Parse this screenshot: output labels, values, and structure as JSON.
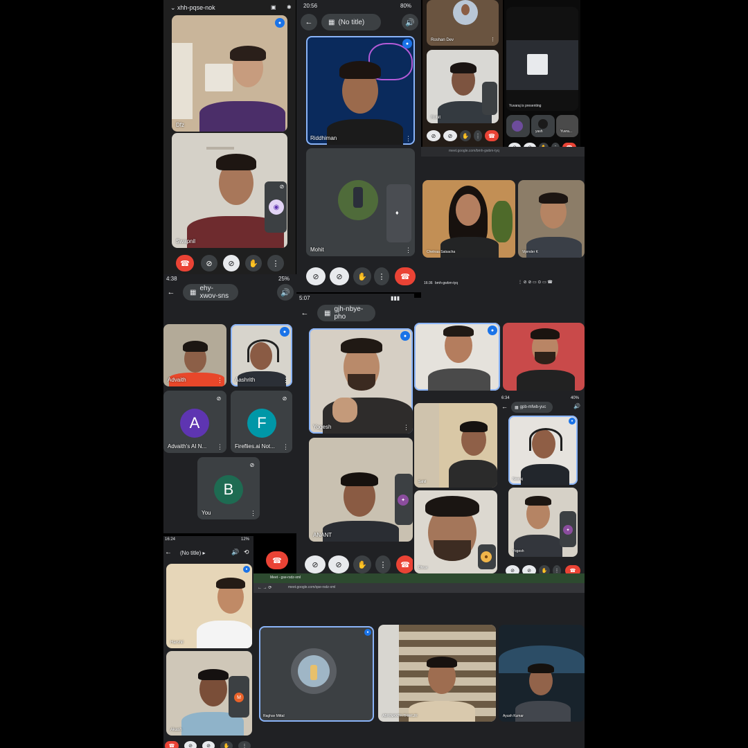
{
  "panel1": {
    "status_left": "xhh-pqse-nok",
    "participants": [
      "Dfz",
      "Swapnil"
    ]
  },
  "panel2": {
    "status_time": "20:56",
    "battery": "80%",
    "title": "(No title)",
    "participants": [
      "Riddhiman",
      "Mohit"
    ]
  },
  "panel3": {
    "participants": [
      "Roshan Dev",
      "Rohit"
    ],
    "presenting": "Yuvaraj is presenting",
    "thumbs": [
      "yash",
      "Yuvra..."
    ]
  },
  "panel4": {
    "url": "meet.google.com/bmh-gwbm-tyq",
    "participants": [
      "Chetnaa Satsacha",
      "Vijender K"
    ],
    "footer_time": "16:36",
    "footer_code": "bmh-gwbm-tyq"
  },
  "panel5": {
    "status_time": "4:38",
    "battery": "25%",
    "meeting_code": "ehy-xwov-sns",
    "participants": [
      "Advaith",
      "Aashrith"
    ],
    "ai_tiles": [
      {
        "letter": "A",
        "name": "Advaith's AI N...",
        "color": "#5e35b1"
      },
      {
        "letter": "F",
        "name": "Fireflies.ai Not...",
        "color": "#0097a7"
      },
      {
        "letter": "B",
        "name": "You",
        "color": "#1e6b52"
      }
    ]
  },
  "panel6": {
    "status_time": "5:07",
    "meeting_code": "gjh-nbye-pho",
    "participants": [
      "Yogesh",
      "ANANT"
    ]
  },
  "panel7": {
    "participants": [
      "",
      "",
      "Sahil",
      "Dhruv"
    ]
  },
  "panel8": {
    "status_time": "6:34",
    "battery": "40%",
    "meeting_code": "gpb-mfwb-yuc",
    "participants": [
      "Neeraj",
      "Yogesh"
    ]
  },
  "panel9": {
    "status_time": "16:24",
    "battery": "12%",
    "title": "(No title)",
    "participants": [
      "Harshil",
      "Akash"
    ]
  },
  "panel10": {
    "tab_title": "Meet - gse-rsdz-xml",
    "url": "meet.google.com/qse-rsdz-xml",
    "participants": [
      "Raghav Mittal",
      "ABHINANTH THAKUR",
      "Ayush Kumar"
    ]
  },
  "icons": {
    "back": "←",
    "speaker": "🔊",
    "more": "⋮",
    "hand": "✋",
    "cam_off": "📷",
    "mic_off": "🎤",
    "end": "☎",
    "calendar": "📅"
  },
  "colors": {
    "accent": "#8ab4f8",
    "end_call": "#ea4335",
    "panel_bg": "#202124",
    "tile_bg": "#3c4043"
  }
}
